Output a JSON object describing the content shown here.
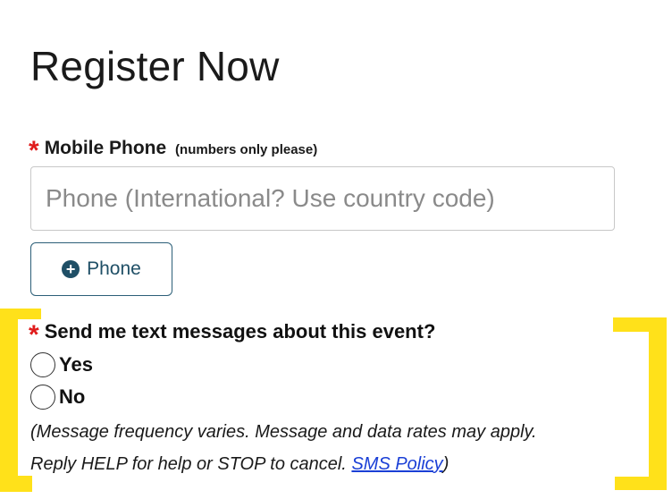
{
  "page": {
    "title": "Register Now"
  },
  "mobile_phone": {
    "required_mark": "*",
    "label": "Mobile Phone",
    "hint": "(numbers only please)",
    "placeholder": "Phone (International? Use country code)",
    "value": "",
    "add_button": {
      "icon": "plus-circle-icon",
      "label": "Phone"
    }
  },
  "sms_opt_in": {
    "required_mark": "*",
    "question": "Send me text messages about this event?",
    "options": [
      {
        "label": "Yes",
        "selected": false
      },
      {
        "label": "No",
        "selected": false
      }
    ],
    "disclaimer_line1": "(Message frequency varies. Message and data rates may apply.",
    "disclaimer_line2": "Reply HELP for help or STOP to cancel.",
    "policy_link": "SMS Policy",
    "disclaimer_close": ")"
  },
  "colors": {
    "required": "#e01b1b",
    "button_border": "#2c5f78",
    "link": "#1a3fd6",
    "highlight": "#ffe11a"
  }
}
